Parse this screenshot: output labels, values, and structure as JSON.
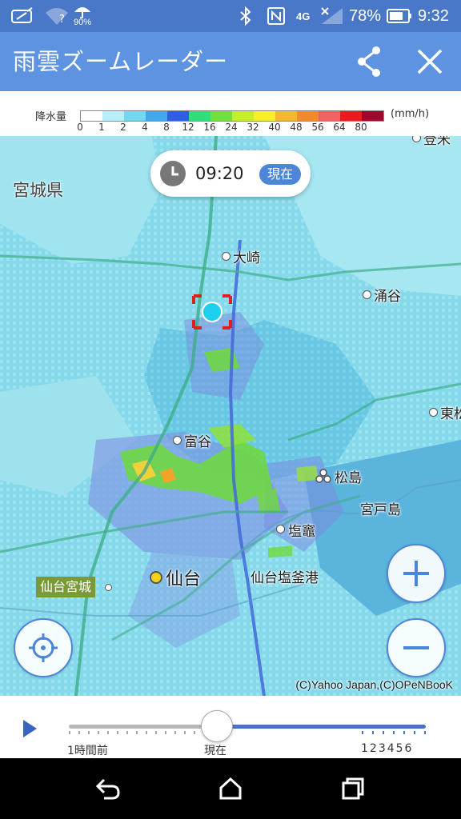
{
  "status_bar": {
    "battery_percent": "78%",
    "time": "9:32",
    "weather_percent": "90%",
    "network": "4G",
    "icons": [
      "app-notification-icon",
      "wifi-question-icon",
      "umbrella-icon",
      "bluetooth-icon",
      "nfc-icon",
      "network-4g-icon",
      "signal-icon",
      "battery-icon"
    ]
  },
  "app_bar": {
    "title": "雨雲ズームレーダー",
    "share_icon": "share-icon",
    "close_icon": "close-icon"
  },
  "legend": {
    "title": "降水量",
    "unit": "(mm/h)",
    "ticks": [
      "0",
      "1",
      "2",
      "4",
      "8",
      "12",
      "16",
      "24",
      "32",
      "40",
      "48",
      "56",
      "64",
      "80"
    ],
    "colors": [
      "#ffffff",
      "#b7f0f8",
      "#6fd9f2",
      "#3fa8ee",
      "#2f5fe8",
      "#2de07a",
      "#6ee23a",
      "#c6ec2e",
      "#f8ee30",
      "#f7b72a",
      "#f48b2a",
      "#f26060",
      "#e81d1d",
      "#a1062c"
    ]
  },
  "map": {
    "time": "09:20",
    "now_badge": "現在",
    "prefecture": "宮城県",
    "places": {
      "osaki": "大崎",
      "wakuya": "涌谷",
      "tomiya": "富谷",
      "matsushima": "松島",
      "miyatojima": "宮戸島",
      "shiogama": "塩竈",
      "sendai": "仙台",
      "sendai_port": "仙台塩釜港",
      "higashi": "東松",
      "tome": "登米"
    },
    "castle_tag": "仙台宮城",
    "copyright": "(C)Yahoo Japan,(C)OPeNBooK"
  },
  "timeline": {
    "label_start": "1時間前",
    "label_now": "現在",
    "label_hours": "123456",
    "progress_fraction": 0.5
  },
  "nav": {
    "back_icon": "back-icon",
    "home_icon": "home-icon",
    "recents_icon": "recents-icon"
  }
}
